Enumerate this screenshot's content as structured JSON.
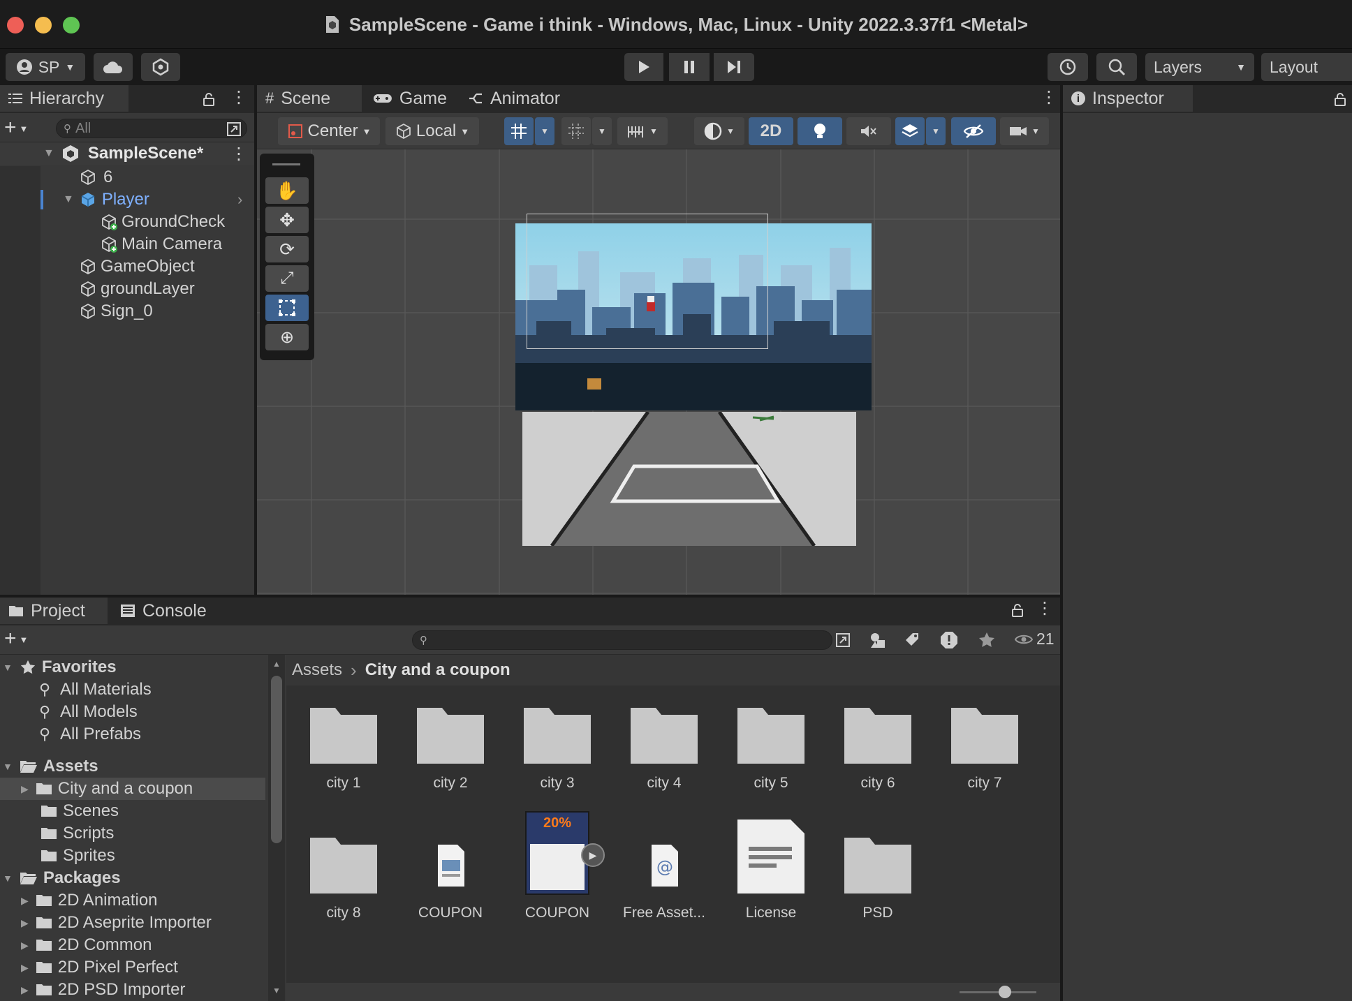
{
  "window": {
    "title": "SampleScene - Game i think - Windows, Mac, Linux - Unity 2022.3.37f1 <Metal>"
  },
  "toolbar": {
    "account_label": "SP",
    "layers_label": "Layers",
    "layout_label": "Layout"
  },
  "hierarchy": {
    "tab_label": "Hierarchy",
    "search_placeholder": "All",
    "scene_name": "SampleScene*",
    "items": [
      {
        "label": "6"
      },
      {
        "label": "Player"
      },
      {
        "label": "GroundCheck"
      },
      {
        "label": "Main Camera"
      },
      {
        "label": "GameObject"
      },
      {
        "label": "groundLayer"
      },
      {
        "label": "Sign_0"
      }
    ]
  },
  "scene_view": {
    "tabs": [
      {
        "label": "Scene"
      },
      {
        "label": "Game"
      },
      {
        "label": "Animator"
      }
    ],
    "pivot_mode": "Center",
    "pivot_space": "Local",
    "mode_2d": "2D"
  },
  "inspector": {
    "tab_label": "Inspector"
  },
  "project": {
    "tabs": [
      {
        "label": "Project"
      },
      {
        "label": "Console"
      }
    ],
    "hidden_count": "21",
    "breadcrumb": {
      "root": "Assets",
      "current": "City and a coupon"
    },
    "favorites": {
      "label": "Favorites",
      "items": [
        {
          "label": "All Materials"
        },
        {
          "label": "All Models"
        },
        {
          "label": "All Prefabs"
        }
      ]
    },
    "assets": {
      "label": "Assets",
      "items": [
        {
          "label": "City and a coupon"
        },
        {
          "label": "Scenes"
        },
        {
          "label": "Scripts"
        },
        {
          "label": "Sprites"
        }
      ]
    },
    "packages": {
      "label": "Packages",
      "items": [
        {
          "label": "2D Animation"
        },
        {
          "label": "2D Aseprite Importer"
        },
        {
          "label": "2D Common"
        },
        {
          "label": "2D Pixel Perfect"
        },
        {
          "label": "2D PSD Importer"
        }
      ]
    },
    "grid_items": [
      {
        "label": "city 1",
        "icon": "folder-icon"
      },
      {
        "label": "city 2",
        "icon": "folder-icon"
      },
      {
        "label": "city 3",
        "icon": "folder-icon"
      },
      {
        "label": "city 4",
        "icon": "folder-icon"
      },
      {
        "label": "city 5",
        "icon": "folder-icon"
      },
      {
        "label": "city 6",
        "icon": "folder-icon"
      },
      {
        "label": "city 7",
        "icon": "folder-icon"
      },
      {
        "label": "city 8",
        "icon": "folder-icon"
      },
      {
        "label": "COUPON",
        "icon": "document-icon"
      },
      {
        "label": "COUPON",
        "icon": "coupon-thumbnail"
      },
      {
        "label": "Free Asset...",
        "icon": "web-document-icon"
      },
      {
        "label": "License",
        "icon": "text-file-icon"
      },
      {
        "label": "PSD",
        "icon": "folder-icon"
      }
    ],
    "coupon_thumbnail_text": "20%"
  },
  "colors": {
    "selection_blue": "#3d6290",
    "player_text": "#7fb1ff",
    "panel_bg": "#383838",
    "scene_bg": "#474747"
  }
}
